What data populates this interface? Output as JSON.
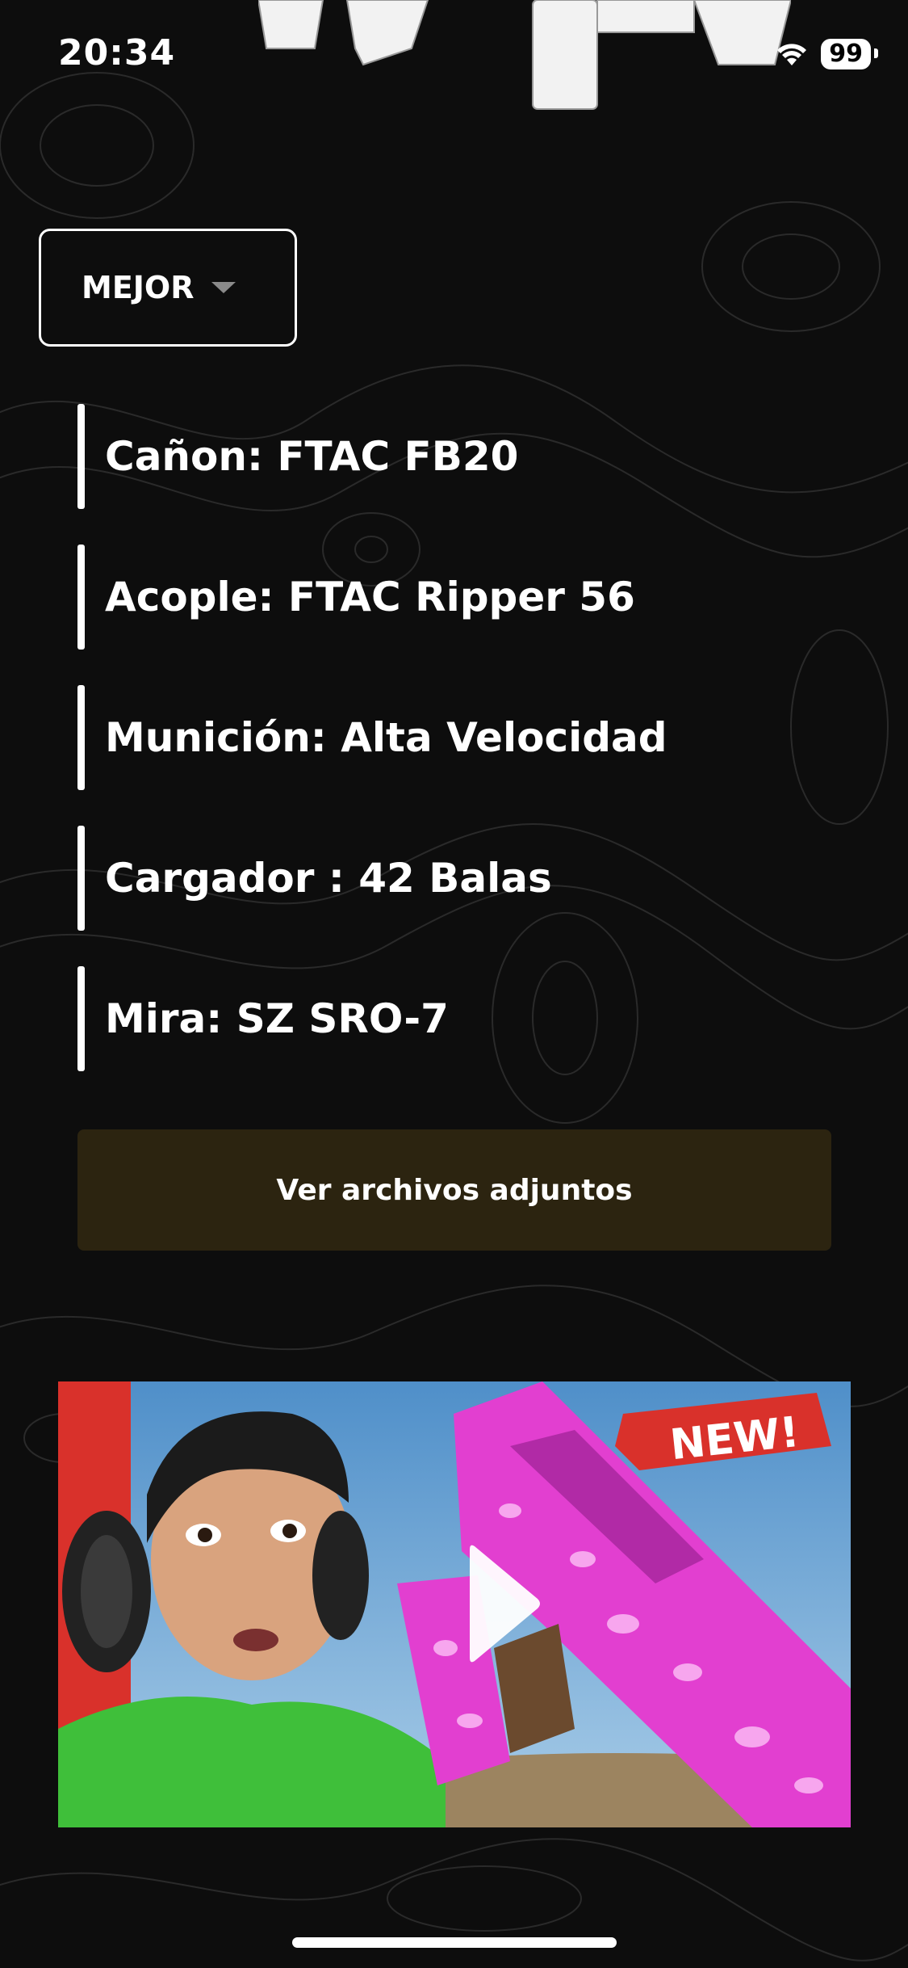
{
  "status_bar": {
    "time": "20:34",
    "battery": "99"
  },
  "filter": {
    "selected": "MEJOR"
  },
  "attachments": [
    {
      "label": "Cañon: FTAC FB20"
    },
    {
      "label": "Acople: FTAC Ripper 56"
    },
    {
      "label": "Munición: Alta Velocidad"
    },
    {
      "label": "Cargador : 42 Balas"
    },
    {
      "label": "Mira: SZ SRO-7"
    }
  ],
  "actions": {
    "view_attachments": "Ver archivos adjuntos"
  },
  "video": {
    "badge_text": "NEW!"
  },
  "colors": {
    "background": "#0d0d0d",
    "button_bg": "#2c2410",
    "badge_red": "#d9312b",
    "gun_pink": "#e23fd0"
  }
}
